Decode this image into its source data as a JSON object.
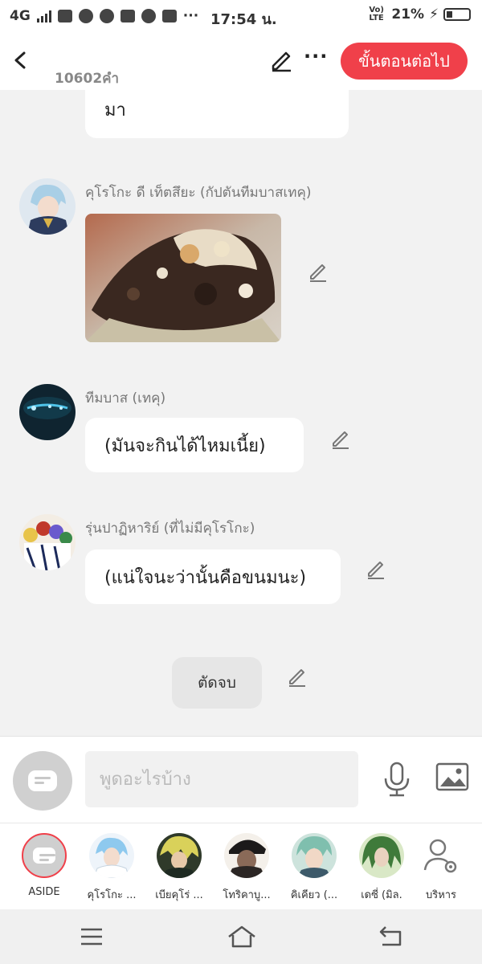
{
  "status_bar": {
    "network": "4G",
    "time": "17:54 น.",
    "volte": "Vo) LTE",
    "battery": "21%"
  },
  "header": {
    "word_count": "10602คำ",
    "next_label": "ขั้นตอนต่อไป"
  },
  "chat": {
    "partial_text": "มา",
    "messages": [
      {
        "speaker": "คุโรโกะ ดี เท็ตสึยะ (กัปตันทีมบาสเทคุ)",
        "type": "image"
      },
      {
        "speaker": "ทีมบาส (เทคุ)",
        "type": "text",
        "text": "(มันจะกินได้ไหมเนี้ย)"
      },
      {
        "speaker": "รุ่นปาฏิหาริย์ (ที่ไม่มีคุโรโกะ)",
        "type": "text",
        "text": "(แน่ใจนะว่านั้นคือขนมนะ)"
      }
    ],
    "end_label": "ตัดจบ"
  },
  "input": {
    "placeholder": "พูดอะไรบ้าง"
  },
  "characters": [
    {
      "name": "ASIDE",
      "color": "#cfcfcf"
    },
    {
      "name": "คุโรโกะ ...",
      "color": "#8ec9ee"
    },
    {
      "name": "เบียคุโร่ ...",
      "color": "#a6a24c"
    },
    {
      "name": "โทริคาบู...",
      "color": "#3d3530"
    },
    {
      "name": "คิเคียว (...",
      "color": "#7fbfae"
    },
    {
      "name": "เดซี่ (มิล.",
      "color": "#3f7a3a"
    },
    {
      "name": "บริหาร",
      "color": "#ffffff"
    }
  ],
  "colors": {
    "accent": "#f0404a",
    "background": "#f2f2f2"
  }
}
